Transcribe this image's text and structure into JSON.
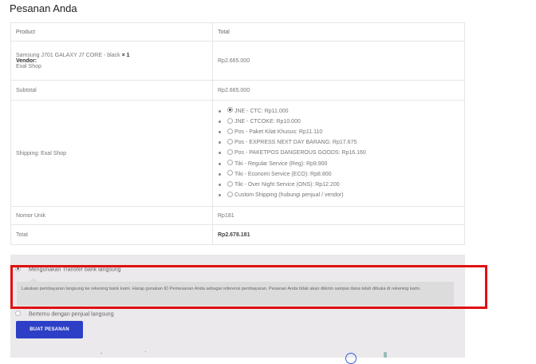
{
  "heading": "Pesanan Anda",
  "table": {
    "col_product": "Product",
    "col_total": "Total",
    "product": {
      "name": "Samsung J701 GALAXY J7 CORE - black",
      "qty": "× 1",
      "vendor_label": "Vendor:",
      "vendor_name": "Exal Shop",
      "total": "Rp2.665.000"
    },
    "subtotal_label": "Subtotal",
    "subtotal_value": "Rp2.665.000",
    "shipping_label": "Shipping: Exal Shop",
    "shipping_options": [
      {
        "label": "JNE - CTC: Rp11.000",
        "selected": true
      },
      {
        "label": "JNE - CTCOKE: Rp10.000",
        "selected": false
      },
      {
        "label": "Pos - Paket Kilat Khusus: Rp11.110",
        "selected": false
      },
      {
        "label": "Pos - EXPRESS NEXT DAY BARANG: Rp17.675",
        "selected": false
      },
      {
        "label": "Pos - PAKETPOS DANGEROUS GOODS: Rp16.160",
        "selected": false
      },
      {
        "label": "Tiki - Regular Service (Reg): Rp9.900",
        "selected": false
      },
      {
        "label": "Tiki - Economi Service (ECO): Rp8.800",
        "selected": false
      },
      {
        "label": "Tiki - Over Night Service (ONS): Rp12.200",
        "selected": false
      },
      {
        "label": "Custom Shipping (hubungi penjual / vendor)",
        "selected": false
      }
    ],
    "unik_label": "Nomor Unik",
    "unik_value": "Rp181",
    "total_label": "Total",
    "total_value": "Rp2.678.181"
  },
  "payment": {
    "option1_label": "Mengunakan Transfer bank langsung",
    "option1_selected": true,
    "option1_desc": "Lakukan pembayaran langsung ke rekening bank kami. Harap gunakan ID Pemesanan Anda sebagai referensi pembayaran. Pesanan Anda tidak akan dikirim sampai dana telah dibuka di rekening kami.",
    "option2_label": "Bertemu dengan penjual langsung",
    "option2_selected": false,
    "place_order_label": "BUAT PESANAN"
  },
  "colors": {
    "highlight": "#e01010",
    "button": "#2c3fc6",
    "payment_bg": "#ebe9eb"
  }
}
